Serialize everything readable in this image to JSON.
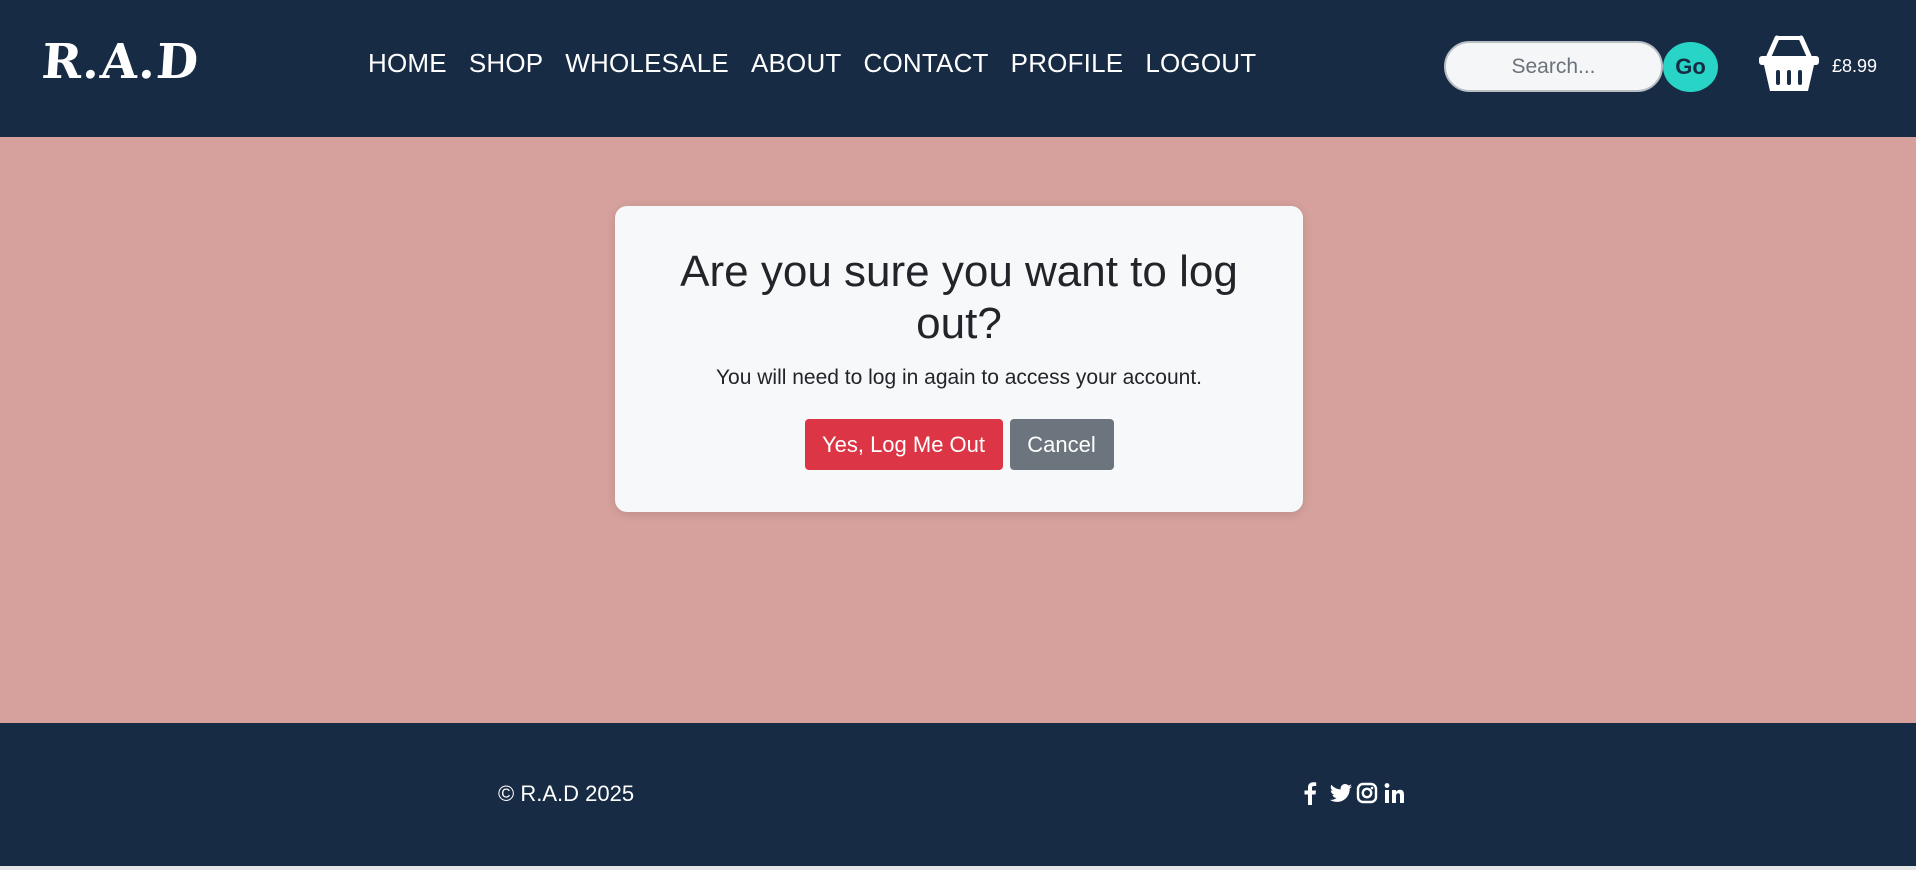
{
  "brand": {
    "logo": "R.A.D"
  },
  "nav": {
    "items": [
      {
        "label": "HOME"
      },
      {
        "label": "SHOP"
      },
      {
        "label": "WHOLESALE"
      },
      {
        "label": "ABOUT"
      },
      {
        "label": "CONTACT"
      },
      {
        "label": "PROFILE"
      },
      {
        "label": "LOGOUT"
      }
    ]
  },
  "search": {
    "placeholder": "Search...",
    "value": "",
    "button_label": "Go"
  },
  "cart": {
    "icon": "basket-icon",
    "total": "£8.99"
  },
  "modal": {
    "title": "Are you sure you want to log out?",
    "message": "You will need to log in again to access your account.",
    "confirm_label": "Yes, Log Me Out",
    "cancel_label": "Cancel"
  },
  "footer": {
    "copyright": "© R.A.D 2025",
    "social_icons": [
      "facebook-icon",
      "twitter-icon",
      "instagram-icon",
      "linkedin-icon"
    ]
  },
  "colors": {
    "header_bg": "#172b45",
    "page_bg": "#d6a19c",
    "accent": "#27d4c6",
    "danger": "#dc3545",
    "secondary": "#6c757d"
  }
}
